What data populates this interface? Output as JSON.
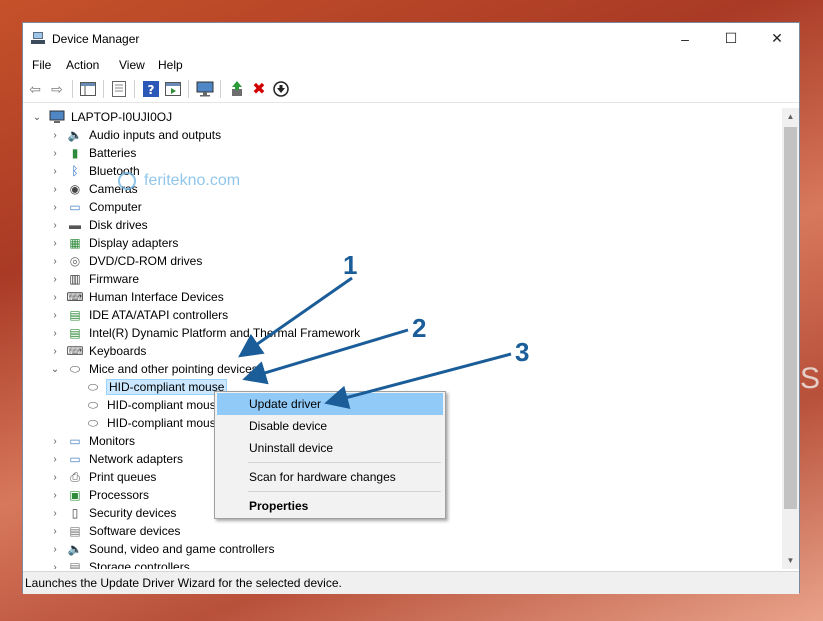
{
  "window": {
    "title": "Device Manager",
    "minimize": "–",
    "maximize": "☐",
    "close": "✕"
  },
  "menu": [
    "File",
    "Action",
    "View",
    "Help"
  ],
  "tree": {
    "root": "LAPTOP-I0UJI0OJ",
    "categories": [
      "Audio inputs and outputs",
      "Batteries",
      "Bluetooth",
      "Cameras",
      "Computer",
      "Disk drives",
      "Display adapters",
      "DVD/CD-ROM drives",
      "Firmware",
      "Human Interface Devices",
      "IDE ATA/ATAPI controllers",
      "Intel(R) Dynamic Platform and Thermal Framework",
      "Keyboards",
      "Mice and other pointing devices",
      "Monitors",
      "Network adapters",
      "Print queues",
      "Processors",
      "Security devices",
      "Software devices",
      "Sound, video and game controllers",
      "Storage controllers"
    ],
    "mice_children": [
      "HID-compliant mouse",
      "HID-compliant mous",
      "HID-compliant mous"
    ]
  },
  "context_menu": {
    "update": "Update driver",
    "disable": "Disable device",
    "uninstall": "Uninstall device",
    "scan": "Scan for hardware changes",
    "properties": "Properties"
  },
  "status": "Launches the Update Driver Wizard for the selected device.",
  "watermark": "feritekno.com",
  "annotations": [
    "1",
    "2",
    "3"
  ],
  "background_text": "SE",
  "colors": {
    "accent": "#1a5d99",
    "highlight": "#91c9f7",
    "selection": "#cce8ff"
  }
}
